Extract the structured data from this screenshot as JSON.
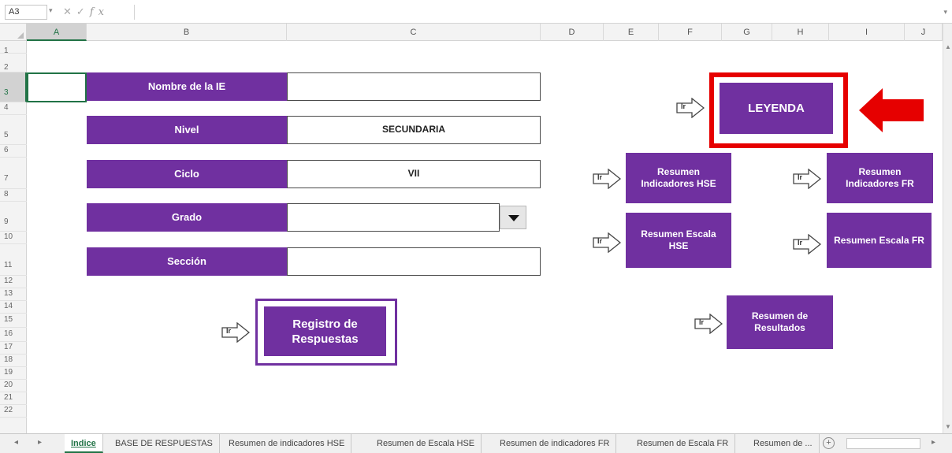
{
  "formula_bar": {
    "name_box": "A3",
    "formula": ""
  },
  "columns": [
    "A",
    "B",
    "C",
    "D",
    "E",
    "F",
    "G",
    "H",
    "I",
    "J"
  ],
  "rows": [
    "1",
    "2",
    "3",
    "4",
    "5",
    "6",
    "7",
    "8",
    "9",
    "10",
    "11",
    "12",
    "13",
    "14",
    "15",
    "16",
    "17",
    "18",
    "19",
    "20",
    "21",
    "22"
  ],
  "selected_cell": "A3",
  "form": {
    "nombre_label": "Nombre de la IE",
    "nombre_value": "",
    "nivel_label": "Nivel",
    "nivel_value": "SECUNDARIA",
    "ciclo_label": "Ciclo",
    "ciclo_value": "VII",
    "grado_label": "Grado",
    "grado_value": "",
    "seccion_label": "Sección",
    "seccion_value": ""
  },
  "buttons": {
    "registro": "Registro de Respuestas",
    "leyenda": "LEYENDA",
    "resumen_indicadores_hse": "Resumen Indicadores HSE",
    "resumen_indicadores_fr": "Resumen Indicadores FR",
    "resumen_escala_hse": "Resumen Escala HSE",
    "resumen_escala_fr": "Resumen Escala FR",
    "resumen_resultados": "Resumen de Resultados",
    "ir_label": "Ir"
  },
  "sheet_tabs": [
    "Indice",
    "BASE DE RESPUESTAS",
    "Resumen de indicadores HSE",
    "Resumen de Escala HSE",
    "Resumen de indicadores FR",
    "Resumen de Escala FR",
    "Resumen de ..."
  ],
  "active_tab": "Indice",
  "colors": {
    "purple": "#7030a0",
    "highlight_red": "#e60000",
    "excel_green": "#217346"
  }
}
